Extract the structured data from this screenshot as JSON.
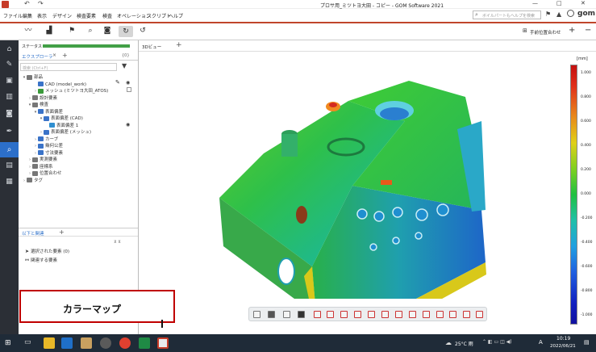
{
  "title": {
    "window_title": "プロサ用_ミツトヨ大田 - コピー - GOM Software 2021",
    "minimize": "—",
    "maximize": "□",
    "close": "✕"
  },
  "menu": {
    "items": [
      "ファイル",
      "編集",
      "表示",
      "デザイン",
      "検査要素",
      "検査",
      "オペレーション",
      "スクリプト",
      "ヘルプ"
    ],
    "search_placeholder": "ボイルパートもヘルプを検索",
    "logo": "gom"
  },
  "toolbar": {
    "alignment_label": "手前位置合わせ",
    "plus": "+",
    "minus": "−"
  },
  "status": {
    "label": "ステータス",
    "progress": 1.0
  },
  "explorer": {
    "tab_label": "エクスプローラ",
    "tab_close": "×",
    "tab_add": "+",
    "filter_count": "{0}",
    "search_placeholder": "検索 (Ctrl+F)",
    "rows": [
      {
        "label": "部品",
        "indent": 0,
        "twisty": "▾",
        "color": "#777"
      },
      {
        "label": "CAD (model_work)",
        "indent": 2,
        "twisty": "",
        "color": "#3a73c8"
      },
      {
        "label": "メッシュ (ミツトヨ大田_ATOS)",
        "indent": 2,
        "twisty": "›",
        "color": "#3a9a3a"
      },
      {
        "label": "設計要素",
        "indent": 1,
        "twisty": "›",
        "color": "#777"
      },
      {
        "label": "検査",
        "indent": 1,
        "twisty": "▾",
        "color": "#777"
      },
      {
        "label": "表面偏差",
        "indent": 2,
        "twisty": "▾",
        "color": "#3a73c8"
      },
      {
        "label": "表面偏差 (CAD)",
        "indent": 3,
        "twisty": "▾",
        "color": "#3a73c8"
      },
      {
        "label": "表面偏差 1",
        "indent": 4,
        "twisty": "",
        "color": "#2f8fd0"
      },
      {
        "label": "表面偏差 (メッシュ)",
        "indent": 3,
        "twisty": "›",
        "color": "#3a73c8"
      },
      {
        "label": "カーブ",
        "indent": 2,
        "twisty": "›",
        "color": "#3a73c8"
      },
      {
        "label": "幾何公差",
        "indent": 2,
        "twisty": "›",
        "color": "#3a73c8"
      },
      {
        "label": "寸法要素",
        "indent": 2,
        "twisty": "›",
        "color": "#3a73c8"
      },
      {
        "label": "実測要素",
        "indent": 1,
        "twisty": "›",
        "color": "#777"
      },
      {
        "label": "座標系",
        "indent": 1,
        "twisty": "›",
        "color": "#777"
      },
      {
        "label": "位置合わせ",
        "indent": 1,
        "twisty": "›",
        "color": "#777"
      },
      {
        "label": "タグ",
        "indent": 0,
        "twisty": "›",
        "color": "#777"
      }
    ]
  },
  "related": {
    "tab_label": "以下と関連",
    "tab_add": "+",
    "rows": [
      "選択された要素 (0)",
      "関連する要素"
    ]
  },
  "viewport": {
    "tab_label": "3Dビュー",
    "tab_add": "+"
  },
  "annotation": {
    "text": "カラーマップ"
  },
  "colorbar": {
    "unit": "[mm]",
    "ticks": [
      "1.000",
      "0.800",
      "0.600",
      "0.400",
      "0.200",
      "0.000",
      "-0.200",
      "-0.400",
      "-0.600",
      "-0.800",
      "-1.000"
    ]
  },
  "taskbar": {
    "weather": "25°C 雨",
    "ime": "A",
    "time": "10:19",
    "date": "2022/06/21"
  }
}
